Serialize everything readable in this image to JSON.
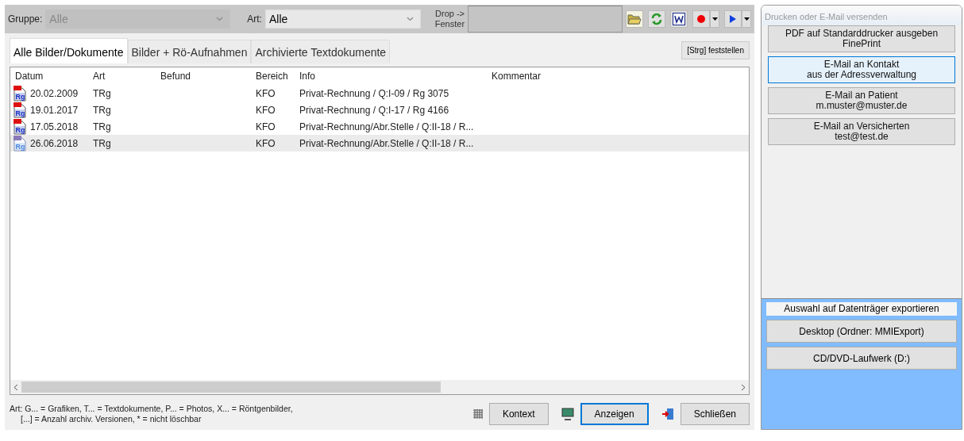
{
  "toolbar": {
    "gruppe": {
      "label": "Gruppe:",
      "value": "Alle",
      "disabled": true
    },
    "art": {
      "label": "Art:",
      "value": "Alle",
      "disabled": false
    },
    "drop_label": [
      "Drop ->",
      "Fenster"
    ]
  },
  "tabs": [
    {
      "label": "Alle Bilder/Dokumente",
      "selected": true
    },
    {
      "label": "Bilder + Rö-Aufnahmen",
      "selected": false
    },
    {
      "label": "Archivierte Textdokumente",
      "selected": false
    }
  ],
  "lock_button": "[Strg]  feststellen",
  "table": {
    "columns": [
      "Datum",
      "Art",
      "Befund",
      "Bereich",
      "Info",
      "Kommentar"
    ],
    "rows": [
      {
        "icon_text": "Rg",
        "datum": "20.02.2009",
        "art": "TRg",
        "bereich": "KFO",
        "info": "Privat-Rechnung / Q:I-09 / Rg 3075",
        "selected": false
      },
      {
        "icon_text": "Rg",
        "datum": "19.01.2017",
        "art": "TRg",
        "bereich": "KFO",
        "info": "Privat-Rechnung / Q:I-17 / Rg 4166",
        "selected": false
      },
      {
        "icon_text": "Rg",
        "datum": "17.05.2018",
        "art": "TRg",
        "bereich": "KFO",
        "info": "Privat-Rechnung/Abr.Stelle / Q:II-18 / R...",
        "selected": false
      },
      {
        "icon_text": "Rg",
        "datum": "26.06.2018",
        "art": "TRg",
        "bereich": "KFO",
        "info": "Privat-Rechnung/Abr.Stelle / Q:II-18 / R...",
        "selected": true
      }
    ]
  },
  "legend": [
    "Art: G... = Grafiken,  T... = Textdokumente,  P... = Photos,  X... = Röntgenbilder,",
    "[...] = Anzahl archiv. Versionen,  * = nicht löschbar"
  ],
  "footer_buttons": [
    {
      "label": "Kontext",
      "kind": "context",
      "default": false
    },
    {
      "label": "Anzeigen",
      "kind": "show",
      "default": true
    },
    {
      "label": "Schließen",
      "kind": "close",
      "default": false
    }
  ],
  "side_panel": {
    "title": "Drucken oder E-Mail versenden",
    "buttons": [
      {
        "lines": [
          "PDF auf Standarddrucker ausgeben",
          "FinePrint"
        ],
        "hovered": false
      },
      {
        "lines": [
          "E-Mail an Kontakt",
          "aus der Adressverwaltung"
        ],
        "hovered": true
      },
      {
        "lines": [
          "E-Mail an Patient",
          "m.muster@muster.de"
        ],
        "hovered": false
      },
      {
        "lines": [
          "E-Mail an Versicherten",
          "test@test.de"
        ],
        "hovered": false
      }
    ],
    "export": {
      "title": "Auswahl auf Datenträger exportieren",
      "buttons": [
        "Desktop (Ordner: MMIExport)",
        "CD/DVD-Laufwerk (D:)"
      ]
    }
  }
}
